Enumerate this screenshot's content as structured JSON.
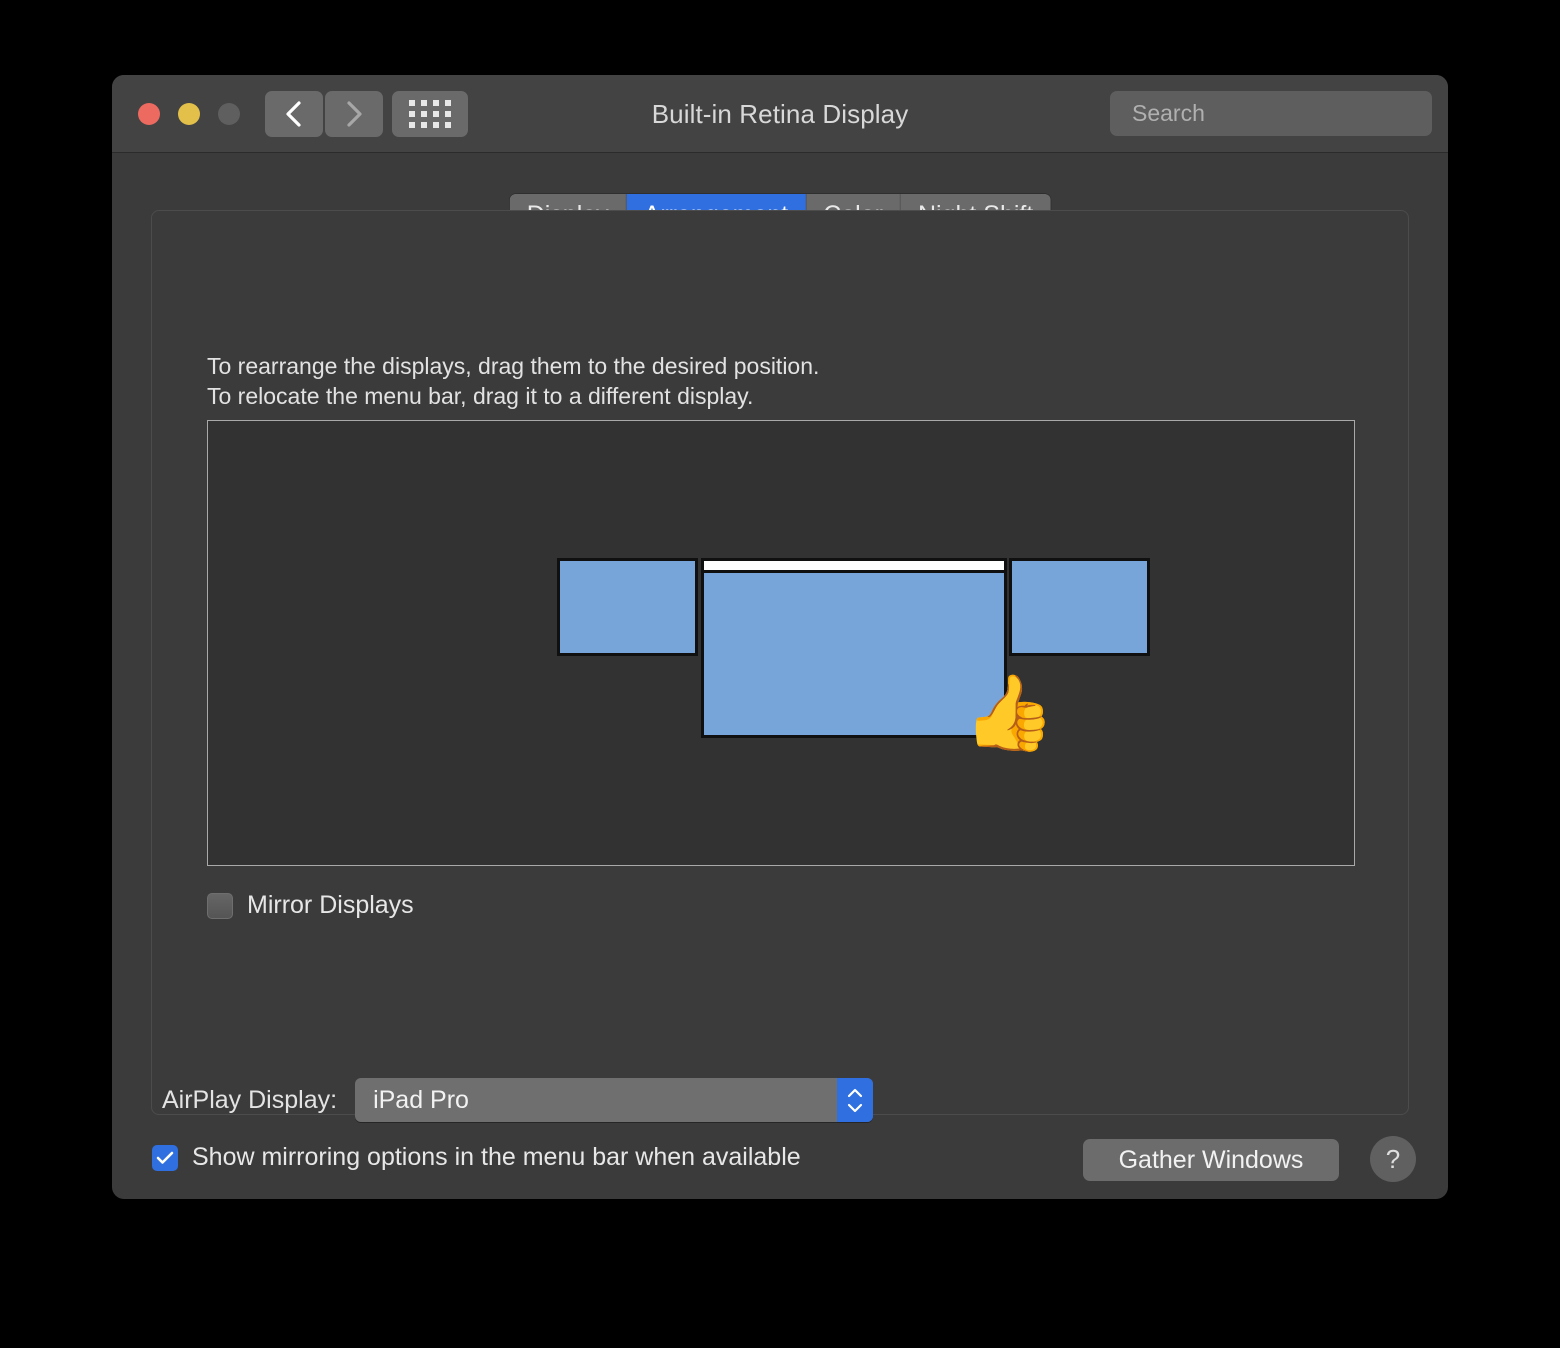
{
  "window": {
    "title": "Built-in Retina Display",
    "traffic_lights": {
      "close_color": "#ec6a5f",
      "minimize_color": "#e3c04a",
      "zoom_color": "#5f5f5f"
    },
    "nav": {
      "back_icon": "chevron-left-icon",
      "forward_icon": "chevron-right-icon",
      "grid_icon": "grid-dots-icon"
    },
    "search": {
      "placeholder": "Search",
      "value": "",
      "icon": "search-icon"
    }
  },
  "tabs": [
    {
      "label": "Display",
      "active": false
    },
    {
      "label": "Arrangement",
      "active": true
    },
    {
      "label": "Color",
      "active": false
    },
    {
      "label": "Night Shift",
      "active": false
    }
  ],
  "main": {
    "instructions": "To rearrange the displays, drag them to the desired position.\nTo relocate the menu bar, drag it to a different display.",
    "arrangement": {
      "displays": [
        {
          "name": "left-display",
          "has_menu_bar": false
        },
        {
          "name": "center-display",
          "has_menu_bar": true
        },
        {
          "name": "right-display",
          "has_menu_bar": false
        }
      ],
      "cursor_emoji": "👍",
      "display_fill_color": "#77a5d9",
      "menu_bar_color": "#ffffff"
    },
    "mirror_displays": {
      "label": "Mirror Displays",
      "checked": false
    }
  },
  "footer": {
    "airplay": {
      "label": "AirPlay Display:",
      "value": "iPad Pro",
      "options": [
        "iPad Pro"
      ],
      "stepper_icon": "chevron-up-down-icon",
      "accent_color": "#2f6fe0"
    },
    "show_mirroring": {
      "label": "Show mirroring options in the menu bar when available",
      "checked": true
    },
    "gather_windows_label": "Gather Windows",
    "help_label": "?"
  }
}
